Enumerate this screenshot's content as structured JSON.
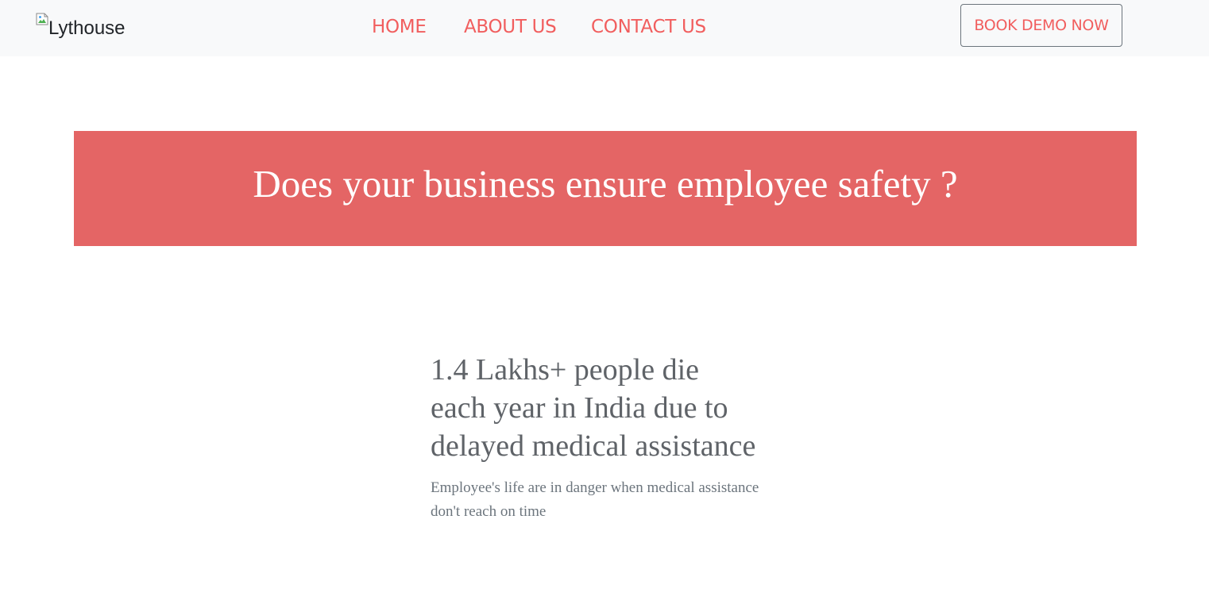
{
  "navbar": {
    "logo_alt": "Lythouse",
    "links": [
      {
        "label": "HOME"
      },
      {
        "label": "ABOUT US"
      },
      {
        "label": "CONTACT US"
      }
    ],
    "cta_label": "BOOK DEMO NOW"
  },
  "banner": {
    "title": "Does your business ensure employee safety ?"
  },
  "stat": {
    "heading_lines": [
      "1.4 Lakhs+ people die",
      "each year in India due to",
      "delayed medical assistance"
    ],
    "description_lines": [
      "Employee's life are in danger when medical assistance",
      "don't reach on time"
    ]
  },
  "colors": {
    "accent": "#f15e5e",
    "banner_bg": "#e46565",
    "navbar_bg": "#f8f9fa",
    "heading_text": "#5f6368",
    "body_text": "#6c757d"
  },
  "icons": {
    "logo": "broken-image-icon"
  }
}
